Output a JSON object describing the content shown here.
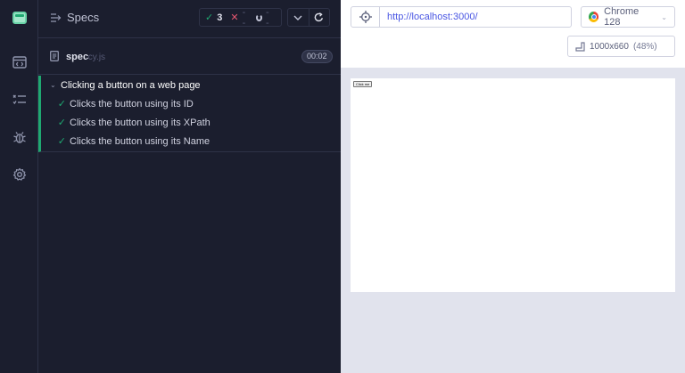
{
  "nav": {
    "items": [
      "logo",
      "specs",
      "runs",
      "debug",
      "settings"
    ]
  },
  "reporter": {
    "title": "Specs",
    "stats": {
      "passed": "3",
      "failed": "--",
      "pending": "--"
    },
    "spec": {
      "name": "spec",
      "ext": ".cy.js",
      "duration": "00:02"
    },
    "suite": {
      "title": "Clicking a button on a web page",
      "tests": [
        "Clicks the button using its ID",
        "Clicks the button using its XPath",
        "Clicks the button using its Name"
      ]
    }
  },
  "app": {
    "url": "http://localhost:3000/",
    "browser": "Chrome 128",
    "viewport": {
      "size": "1000x660",
      "scale": "(48%)"
    },
    "aut_button_label": "Click me"
  },
  "colors": {
    "pass": "#1fa971",
    "fail": "#e45770",
    "panel_bg": "#1b1e2e",
    "app_bg": "#e1e3ed",
    "url_text": "#4956e3"
  }
}
